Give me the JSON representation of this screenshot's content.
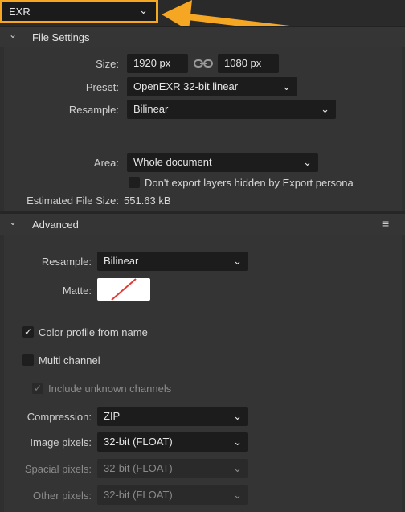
{
  "topbar": {
    "format_value": "EXR"
  },
  "file_settings": {
    "title": "File Settings",
    "size_label": "Size:",
    "width_value": "1920 px",
    "height_value": "1080 px",
    "preset_label": "Preset:",
    "preset_value": "OpenEXR 32-bit linear",
    "resample_label": "Resample:",
    "resample_value": "Bilinear",
    "area_label": "Area:",
    "area_value": "Whole document",
    "dont_export_label": "Don't export layers hidden by Export persona",
    "dont_export_checked": false,
    "estimated_label": "Estimated File Size:",
    "estimated_value": "551.63 kB"
  },
  "advanced": {
    "title": "Advanced",
    "resample_label": "Resample:",
    "resample_value": "Bilinear",
    "matte_label": "Matte:",
    "color_profile_label": "Color profile from name",
    "color_profile_checked": true,
    "multi_channel_label": "Multi channel",
    "multi_channel_checked": false,
    "include_unknown_label": "Include unknown channels",
    "include_unknown_checked": true,
    "compression_label": "Compression:",
    "compression_value": "ZIP",
    "image_pixels_label": "Image pixels:",
    "image_pixels_value": "32-bit (FLOAT)",
    "spacial_pixels_label": "Spacial pixels:",
    "spacial_pixels_value": "32-bit (FLOAT)",
    "other_pixels_label": "Other pixels:",
    "other_pixels_value": "32-bit (FLOAT)"
  },
  "colors": {
    "highlight": "#f5a623",
    "matte_slash": "#e53935"
  },
  "icons": {
    "chevron": "chevron-down-icon",
    "caret": "caret-down-icon",
    "link": "link-icon",
    "menu": "hamburger-menu-icon",
    "check": "checkmark-icon",
    "arrow": "pointer-arrow-icon"
  }
}
